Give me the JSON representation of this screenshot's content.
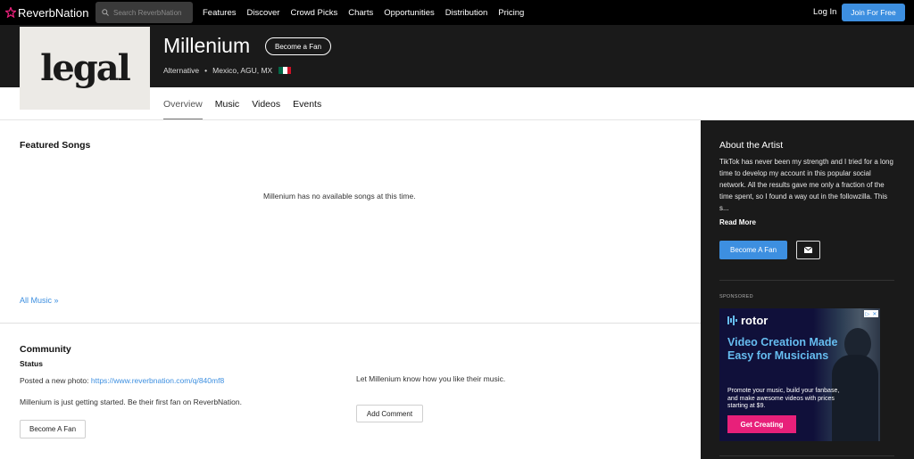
{
  "nav": {
    "logo": "ReverbNation",
    "search_placeholder": "Search ReverbNation",
    "links": [
      "Features",
      "Discover",
      "Crowd Picks",
      "Charts",
      "Opportunities",
      "Distribution",
      "Pricing"
    ],
    "login": "Log In",
    "join": "Join For Free"
  },
  "artist": {
    "logo_text": "legal",
    "name": "Millenium",
    "become_fan": "Become a Fan",
    "genre": "Alternative",
    "separator": "•",
    "location": "Mexico, AGU, MX",
    "flag_colors": [
      "#006847",
      "#ffffff",
      "#ce1126"
    ]
  },
  "tabs": [
    "Overview",
    "Music",
    "Videos",
    "Events"
  ],
  "featured": {
    "title": "Featured Songs",
    "empty": "Millenium has no available songs at this time.",
    "all_music": "All Music »"
  },
  "community": {
    "title": "Community",
    "status_label": "Status",
    "post_prefix": "Posted a new photo: ",
    "post_link": "https://www.reverbnation.com/q/840mf8",
    "fan_message": "Millenium is just getting started. Be their first fan on ReverbNation.",
    "become_fan": "Become A Fan",
    "comment_prompt": "Let Millenium know how you like their music.",
    "add_comment": "Add Comment"
  },
  "about": {
    "title": "About the Artist",
    "bio": "TikTok has never been my strength and I tried for a long time to develop my account in this popular social network. All the results gave me only a fraction of the time spent, so I found a way out in the followzilla. This s...",
    "read_more": "Read More",
    "become_fan": "Become A Fan",
    "message_icon": "envelope-icon"
  },
  "sponsored": {
    "label": "SPONSORED",
    "brand": "rotor",
    "headline": "Video Creation Made Easy for Musicians",
    "copy": "Promote your music, build your fanbase, and make awesome videos with prices starting at $9.",
    "cta": "Get Creating"
  },
  "colors": {
    "accent": "#3d8fe0",
    "header_bg": "#1a1a1a",
    "topbar_bg": "#000000",
    "ad_cta": "#e8207a",
    "ad_headline": "#66bdf0"
  }
}
